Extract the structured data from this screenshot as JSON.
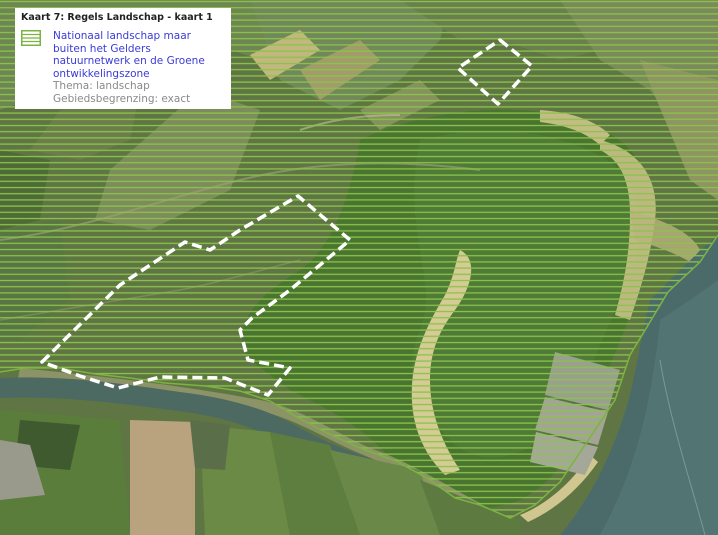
{
  "map": {
    "title": "Kaart 7: Regels Landschap - kaart 1",
    "colors": {
      "hatch": "#8bc34a",
      "boundary_outline": "#7cb342",
      "dashed_boundary": "#ffffff",
      "legend_label": "#3b3bd6",
      "legend_meta": "#8a8a8a"
    },
    "legend": {
      "items": [
        {
          "symbol": "horizontal-hatch-icon",
          "label": "Nationaal landschap maar buiten het Gelders natuurnetwerk en de Groene ontwikkelingszone",
          "theme": "Thema: landschap",
          "boundary": "Gebiedsbegrenzing: exact"
        }
      ]
    }
  }
}
